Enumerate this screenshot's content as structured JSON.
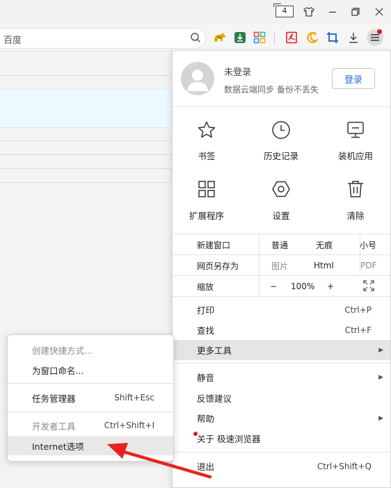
{
  "titlebar": {
    "tab_count": "4"
  },
  "address_bar": {
    "placeholder": "百度"
  },
  "account": {
    "title": "未登录",
    "subtitle": "数据云端同步 备份不丢失",
    "login_label": "登录"
  },
  "grid": [
    {
      "label": "书签",
      "icon": "star-icon"
    },
    {
      "label": "历史记录",
      "icon": "clock-icon"
    },
    {
      "label": "装机应用",
      "icon": "monitor-icon"
    },
    {
      "label": "扩展程序",
      "icon": "extensions-grid-icon"
    },
    {
      "label": "设置",
      "icon": "settings-hexagon-icon"
    },
    {
      "label": "清除",
      "icon": "trash-icon"
    }
  ],
  "window_row": {
    "new_window": "新建窗口",
    "normal": "普通",
    "incognito": "无痕",
    "small": "小号"
  },
  "save_row": {
    "save_as": "网页另存为",
    "image": "图片",
    "html": "Html",
    "pdf": "PDF"
  },
  "zoom_row": {
    "label": "缩放",
    "minus": "−",
    "value": "100%",
    "plus": "+"
  },
  "menu": {
    "print": {
      "label": "打印",
      "shortcut": "Ctrl+P"
    },
    "find": {
      "label": "查找",
      "shortcut": "Ctrl+F"
    },
    "more_tools": {
      "label": "更多工具"
    },
    "mute": {
      "label": "静音"
    },
    "feedback": {
      "label": "反馈建议"
    },
    "help": {
      "label": "帮助"
    },
    "about": {
      "label": "关于 极速浏览器"
    },
    "exit": {
      "label": "退出",
      "shortcut": "Ctrl+Shift+Q"
    }
  },
  "submenu": {
    "create_shortcut": "创建快捷方式...",
    "name_window": "为窗口命名...",
    "task_manager": {
      "label": "任务管理器",
      "shortcut": "Shift+Esc"
    },
    "dev_tools": {
      "label": "开发者工具",
      "shortcut": "Ctrl+Shift+I"
    },
    "internet_options": "Internet选项"
  },
  "colors": {
    "accent_blue": "#2a6bd1",
    "notification_red": "#e0161e",
    "annotation_arrow": "#e8231f"
  }
}
